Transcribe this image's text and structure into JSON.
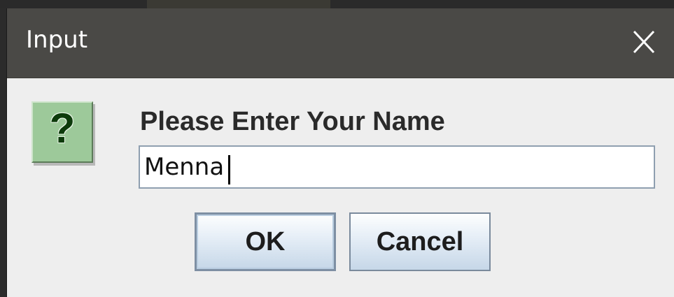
{
  "window": {
    "title": "Input",
    "close_icon": "close-icon"
  },
  "dialog": {
    "icon": "question-icon",
    "icon_glyph": "?",
    "prompt": "Please Enter Your Name",
    "input_value": "Menna",
    "ok_label": "OK",
    "cancel_label": "Cancel"
  },
  "colors": {
    "titlebar": "#4a4946",
    "body": "#eeeeee",
    "icon_bg": "#9dc99a",
    "button_border": "#7a8a9c"
  }
}
